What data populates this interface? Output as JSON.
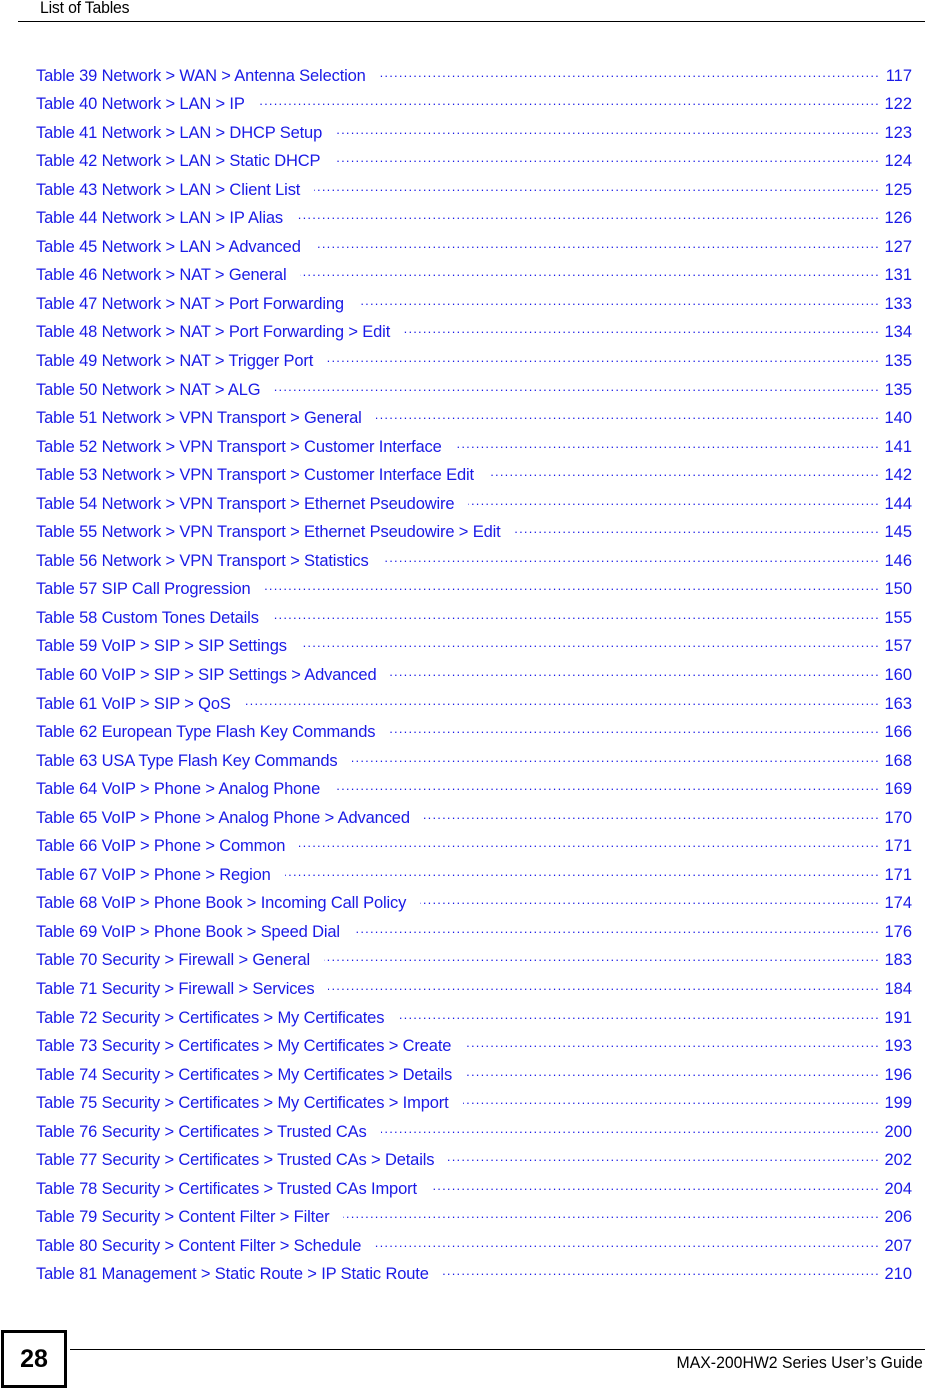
{
  "header": {
    "title": "List of Tables"
  },
  "toc": {
    "link_color": "#1a1ae6",
    "entries": [
      {
        "label": "Table 39 Network > WAN > Antenna Selection",
        "page": "117"
      },
      {
        "label": "Table 40 Network > LAN > IP",
        "page": "122"
      },
      {
        "label": "Table 41 Network > LAN > DHCP Setup",
        "page": "123"
      },
      {
        "label": "Table 42 Network > LAN > Static DHCP",
        "page": "124"
      },
      {
        "label": "Table 43 Network > LAN > Client List",
        "page": "125"
      },
      {
        "label": "Table 44 Network > LAN > IP Alias",
        "page": "126"
      },
      {
        "label": "Table 45 Network > LAN > Advanced",
        "page": "127"
      },
      {
        "label": "Table 46 Network > NAT > General",
        "page": "131"
      },
      {
        "label": "Table 47 Network > NAT > Port Forwarding",
        "page": "133"
      },
      {
        "label": "Table 48 Network > NAT > Port Forwarding > Edit",
        "page": "134"
      },
      {
        "label": "Table 49 Network > NAT > Trigger Port",
        "page": "135"
      },
      {
        "label": "Table 50 Network > NAT > ALG",
        "page": "135"
      },
      {
        "label": "Table 51 Network > VPN Transport > General",
        "page": "140"
      },
      {
        "label": "Table 52 Network > VPN Transport > Customer Interface",
        "page": "141"
      },
      {
        "label": "Table 53 Network > VPN Transport > Customer Interface Edit",
        "page": "142"
      },
      {
        "label": "Table 54 Network > VPN Transport > Ethernet Pseudowire",
        "page": "144"
      },
      {
        "label": "Table 55 Network > VPN Transport > Ethernet Pseudowire > Edit",
        "page": "145"
      },
      {
        "label": "Table 56 Network > VPN Transport > Statistics",
        "page": "146"
      },
      {
        "label": "Table 57 SIP Call Progression",
        "page": "150"
      },
      {
        "label": "Table 58 Custom Tones Details",
        "page": "155"
      },
      {
        "label": "Table 59 VoIP > SIP > SIP Settings",
        "page": "157"
      },
      {
        "label": "Table 60 VoIP > SIP > SIP Settings > Advanced",
        "page": "160"
      },
      {
        "label": "Table 61 VoIP > SIP > QoS",
        "page": "163"
      },
      {
        "label": "Table 62 European Type Flash Key Commands",
        "page": "166"
      },
      {
        "label": "Table 63 USA Type Flash Key Commands",
        "page": "168"
      },
      {
        "label": "Table 64 VoIP > Phone > Analog Phone",
        "page": "169"
      },
      {
        "label": "Table 65 VoIP > Phone > Analog Phone > Advanced",
        "page": "170"
      },
      {
        "label": "Table 66 VoIP > Phone > Common",
        "page": "171"
      },
      {
        "label": "Table 67 VoIP > Phone > Region",
        "page": "171"
      },
      {
        "label": "Table 68 VoIP > Phone Book > Incoming Call Policy",
        "page": "174"
      },
      {
        "label": "Table 69 VoIP > Phone Book > Speed Dial",
        "page": "176"
      },
      {
        "label": "Table 70 Security > Firewall > General",
        "page": "183"
      },
      {
        "label": "Table 71 Security > Firewall > Services",
        "page": "184"
      },
      {
        "label": "Table 72 Security > Certificates > My Certificates",
        "page": "191"
      },
      {
        "label": "Table 73 Security > Certificates > My Certificates > Create",
        "page": "193"
      },
      {
        "label": "Table 74 Security > Certificates > My Certificates > Details",
        "page": "196"
      },
      {
        "label": "Table 75 Security > Certificates > My Certificates > Import",
        "page": "199"
      },
      {
        "label": "Table 76 Security > Certificates > Trusted CAs",
        "page": "200"
      },
      {
        "label": "Table 77 Security > Certificates > Trusted CAs > Details",
        "page": "202"
      },
      {
        "label": "Table 78 Security > Certificates > Trusted CAs Import",
        "page": "204"
      },
      {
        "label": "Table 79 Security > Content Filter > Filter",
        "page": "206"
      },
      {
        "label": "Table 80 Security > Content Filter > Schedule",
        "page": "207"
      },
      {
        "label": "Table 81 Management > Static Route > IP Static Route",
        "page": "210"
      }
    ]
  },
  "footer": {
    "page_number": "28",
    "guide_title": "MAX-200HW2 Series User’s Guide"
  }
}
